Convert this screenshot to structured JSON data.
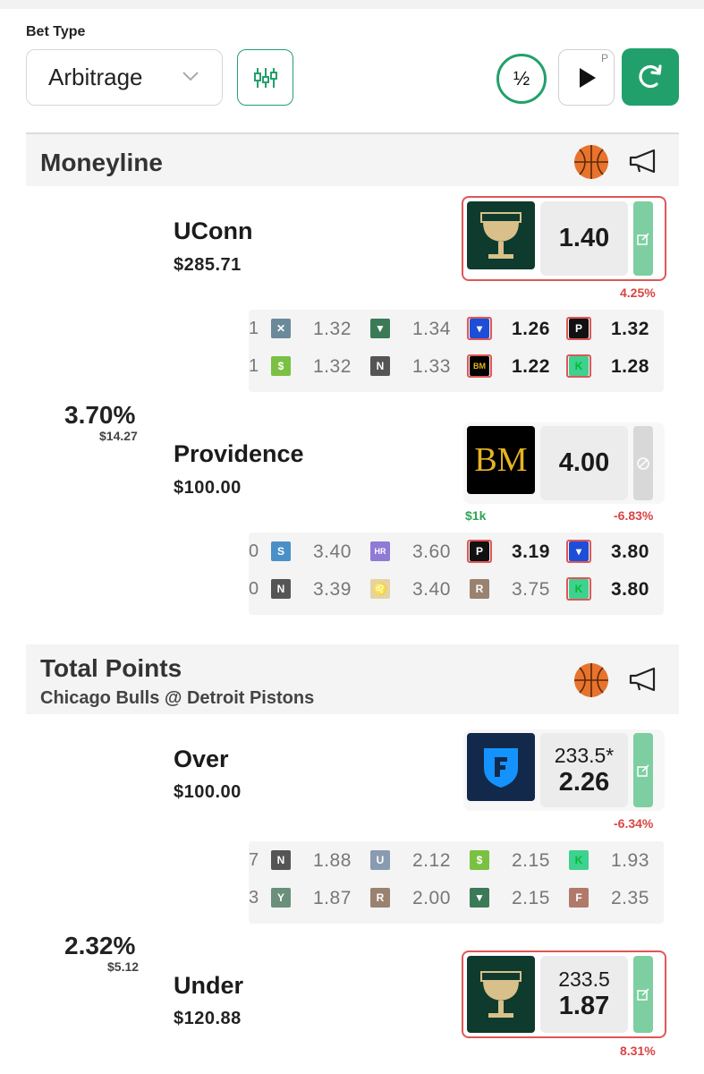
{
  "header": {
    "bet_type_label": "Bet Type",
    "bet_type_value": "Arbitrage",
    "half_label": "½",
    "play_badge": "P"
  },
  "moneyline": {
    "title": "Moneyline",
    "arb_pct": "3.70%",
    "arb_profit": "$14.27",
    "outcomes": [
      {
        "team": "UConn",
        "stake": "$285.71",
        "book_icon": "grail-icon",
        "odds": "1.40",
        "edge": "4.25%",
        "grid": [
          {
            "cut": "1",
            "cells": [
              [
                "x-icon",
                "1.32",
                false
              ],
              [
                "flag-icon",
                "1.34",
                false
              ],
              [
                "fanduel-icon",
                "1.26",
                true
              ],
              [
                "p-icon",
                "1.32",
                true
              ]
            ]
          },
          {
            "cut": "1",
            "cells": [
              [
                "draftkings-icon",
                "1.32",
                false
              ],
              [
                "n-icon",
                "1.33",
                false
              ],
              [
                "bm-icon",
                "1.22",
                true
              ],
              [
                "k-icon",
                "1.28",
                true
              ]
            ]
          }
        ]
      },
      {
        "team": "Providence",
        "stake": "$100.00",
        "book_logo_text": "BM",
        "odds": "4.00",
        "limit": "$1k",
        "edge": "-6.83%",
        "grid": [
          {
            "cut": "0",
            "cells": [
              [
                "s-icon",
                "3.40",
                false
              ],
              [
                "hr-icon",
                "3.60",
                false
              ],
              [
                "p-icon",
                "3.19",
                true
              ],
              [
                "fanduel-icon",
                "3.80",
                true
              ]
            ]
          },
          {
            "cut": "0",
            "cells": [
              [
                "n-icon",
                "3.39",
                false
              ],
              [
                "lion-icon",
                "3.40",
                false
              ],
              [
                "rebet-icon",
                "3.75",
                false
              ],
              [
                "k-icon",
                "3.80",
                true
              ]
            ]
          }
        ]
      }
    ]
  },
  "total_points": {
    "title": "Total Points",
    "subtitle": "Chicago Bulls @ Detroit Pistons",
    "arb_pct": "2.32%",
    "arb_profit": "$5.12",
    "outcomes": [
      {
        "team": "Over",
        "stake": "$100.00",
        "book_icon": "fanduel-icon",
        "line": "233.5*",
        "odds": "2.26",
        "edge": "-6.34%",
        "grid": [
          {
            "cut": "7",
            "cells": [
              [
                "n-icon",
                "1.88",
                false
              ],
              [
                "u-icon",
                "2.12",
                false
              ],
              [
                "draftkings-icon",
                "2.15",
                false
              ],
              [
                "k-icon",
                "1.93",
                false
              ]
            ]
          },
          {
            "cut": "3",
            "cells": [
              [
                "grail-icon",
                "1.87",
                false
              ],
              [
                "rebet-icon",
                "2.00",
                false
              ],
              [
                "flag-icon",
                "2.15",
                false
              ],
              [
                "fliff-icon",
                "2.35",
                false
              ]
            ]
          }
        ]
      },
      {
        "team": "Under",
        "stake": "$120.88",
        "book_icon": "grail-icon",
        "line": "233.5",
        "odds": "1.87",
        "edge": "8.31%"
      }
    ]
  },
  "colors": {
    "accent": "#22a06b",
    "highlight_border": "#e05656",
    "negative": "#d94444",
    "positive": "#31a354"
  }
}
